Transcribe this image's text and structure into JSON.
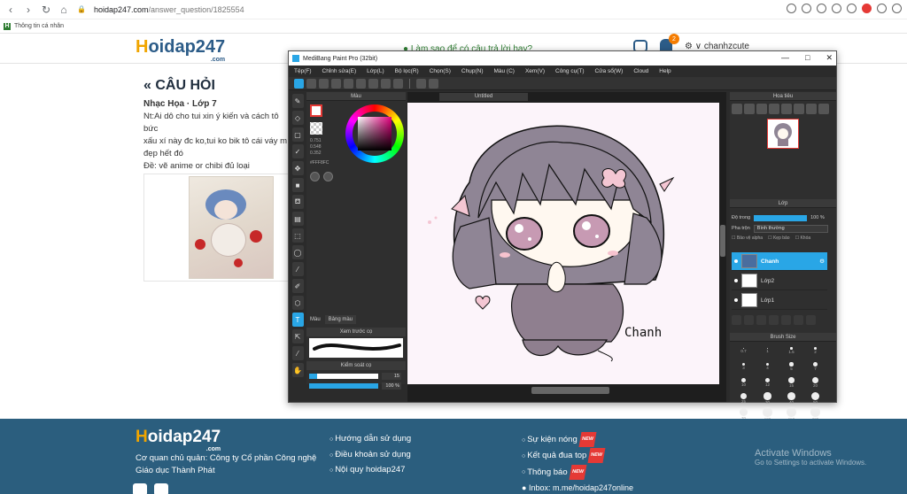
{
  "browser": {
    "url_host": "hoidap247.com",
    "url_path": "/answer_question/1825554",
    "bookmark": "Thông tin cá nhân"
  },
  "header": {
    "logo_h": "H",
    "logo_rest": "oidap247",
    "logo_com": ".com",
    "green_link": "Làm sao để có câu trả lời hay?",
    "badge_count": "2",
    "username": "chanhzcute"
  },
  "question": {
    "title": "« CÂU HỎI",
    "meta": "Nhạc Họa · Lớp 7",
    "body_lines": [
      "Nt:Ai dô cho tui xin ý kiến và cách tô bức",
      "xấu xí này đc ko,tui ko bik tô cái váy m",
      "đẹp hết đó",
      "Đề: vẽ anime or chibi đủ loại"
    ]
  },
  "medibang": {
    "title": "MediBang Paint Pro (32bit)",
    "menu": [
      "Tệp(F)",
      "Chỉnh sửa(E)",
      "Lớp(L)",
      "Bộ lọc(R)",
      "Chọn(S)",
      "Chụp(N)",
      "Màu (C)",
      "Xem(V)",
      "Công cụ(T)",
      "Cửa sổ(W)",
      "Cloud",
      "Help"
    ],
    "color_panel_title": "Màu",
    "color_values": [
      "0.751",
      "0.548",
      "0.352"
    ],
    "hex_value": "#FFF8FC",
    "tabs": [
      "Màu",
      "Bảng màu"
    ],
    "brush_preview_title": "Xem trước cọ",
    "brush_control_title": "Kiểm soát cọ",
    "brush_size": "15",
    "brush_size_fraction": 0.12,
    "brush_opacity": "100 %",
    "brush_opacity_fraction": 1.0,
    "canvas_tab": "Untitled",
    "canvas_signature": "Chanh",
    "navigator_title": "Hoa tiêu",
    "layer_title": "Lớp",
    "opacity_label": "Độ trong",
    "opacity_value": "100 %",
    "blend_label": "Pha trộn",
    "blend_value": "Bình thường",
    "checks": [
      "Bảo vệ alpha",
      "Kẹp bảo",
      "Khóa"
    ],
    "layers": [
      {
        "name": "Chanh",
        "selected": true
      },
      {
        "name": "Lớp2",
        "selected": false
      },
      {
        "name": "Lớp1",
        "selected": false
      }
    ],
    "brush_size_title": "Brush Size",
    "brush_sizes": [
      "0.7",
      "1",
      "1.5",
      "2",
      "3",
      "4",
      "5",
      "7",
      "10",
      "12",
      "15",
      "20",
      "25",
      "30",
      "40",
      "50",
      "70",
      "100",
      "150",
      "200"
    ]
  },
  "footer": {
    "logo_h": "H",
    "logo_rest": "oidap247",
    "logo_com": ".com",
    "desc_line1": "Cơ quan chủ quản: Công ty Cổ phần Công nghệ",
    "desc_line2": "Giáo dục Thành Phát",
    "links1": [
      "Hướng dẫn sử dụng",
      "Điều khoản sử dụng",
      "Nội quy hoidap247"
    ],
    "links2": [
      "Sự kiện nóng",
      "Kết quả đua top",
      "Thông báo"
    ],
    "new_label": "NEW",
    "inbox": "Inbox: m.me/hoidap247online",
    "activate_title": "Activate Windows",
    "activate_sub": "Go to Settings to activate Windows."
  },
  "colors": {
    "brand_blue": "#2c5c88",
    "brand_orange": "#f0a500",
    "footer_bg": "#2b5e7e",
    "mb_accent": "#29a6e6"
  }
}
